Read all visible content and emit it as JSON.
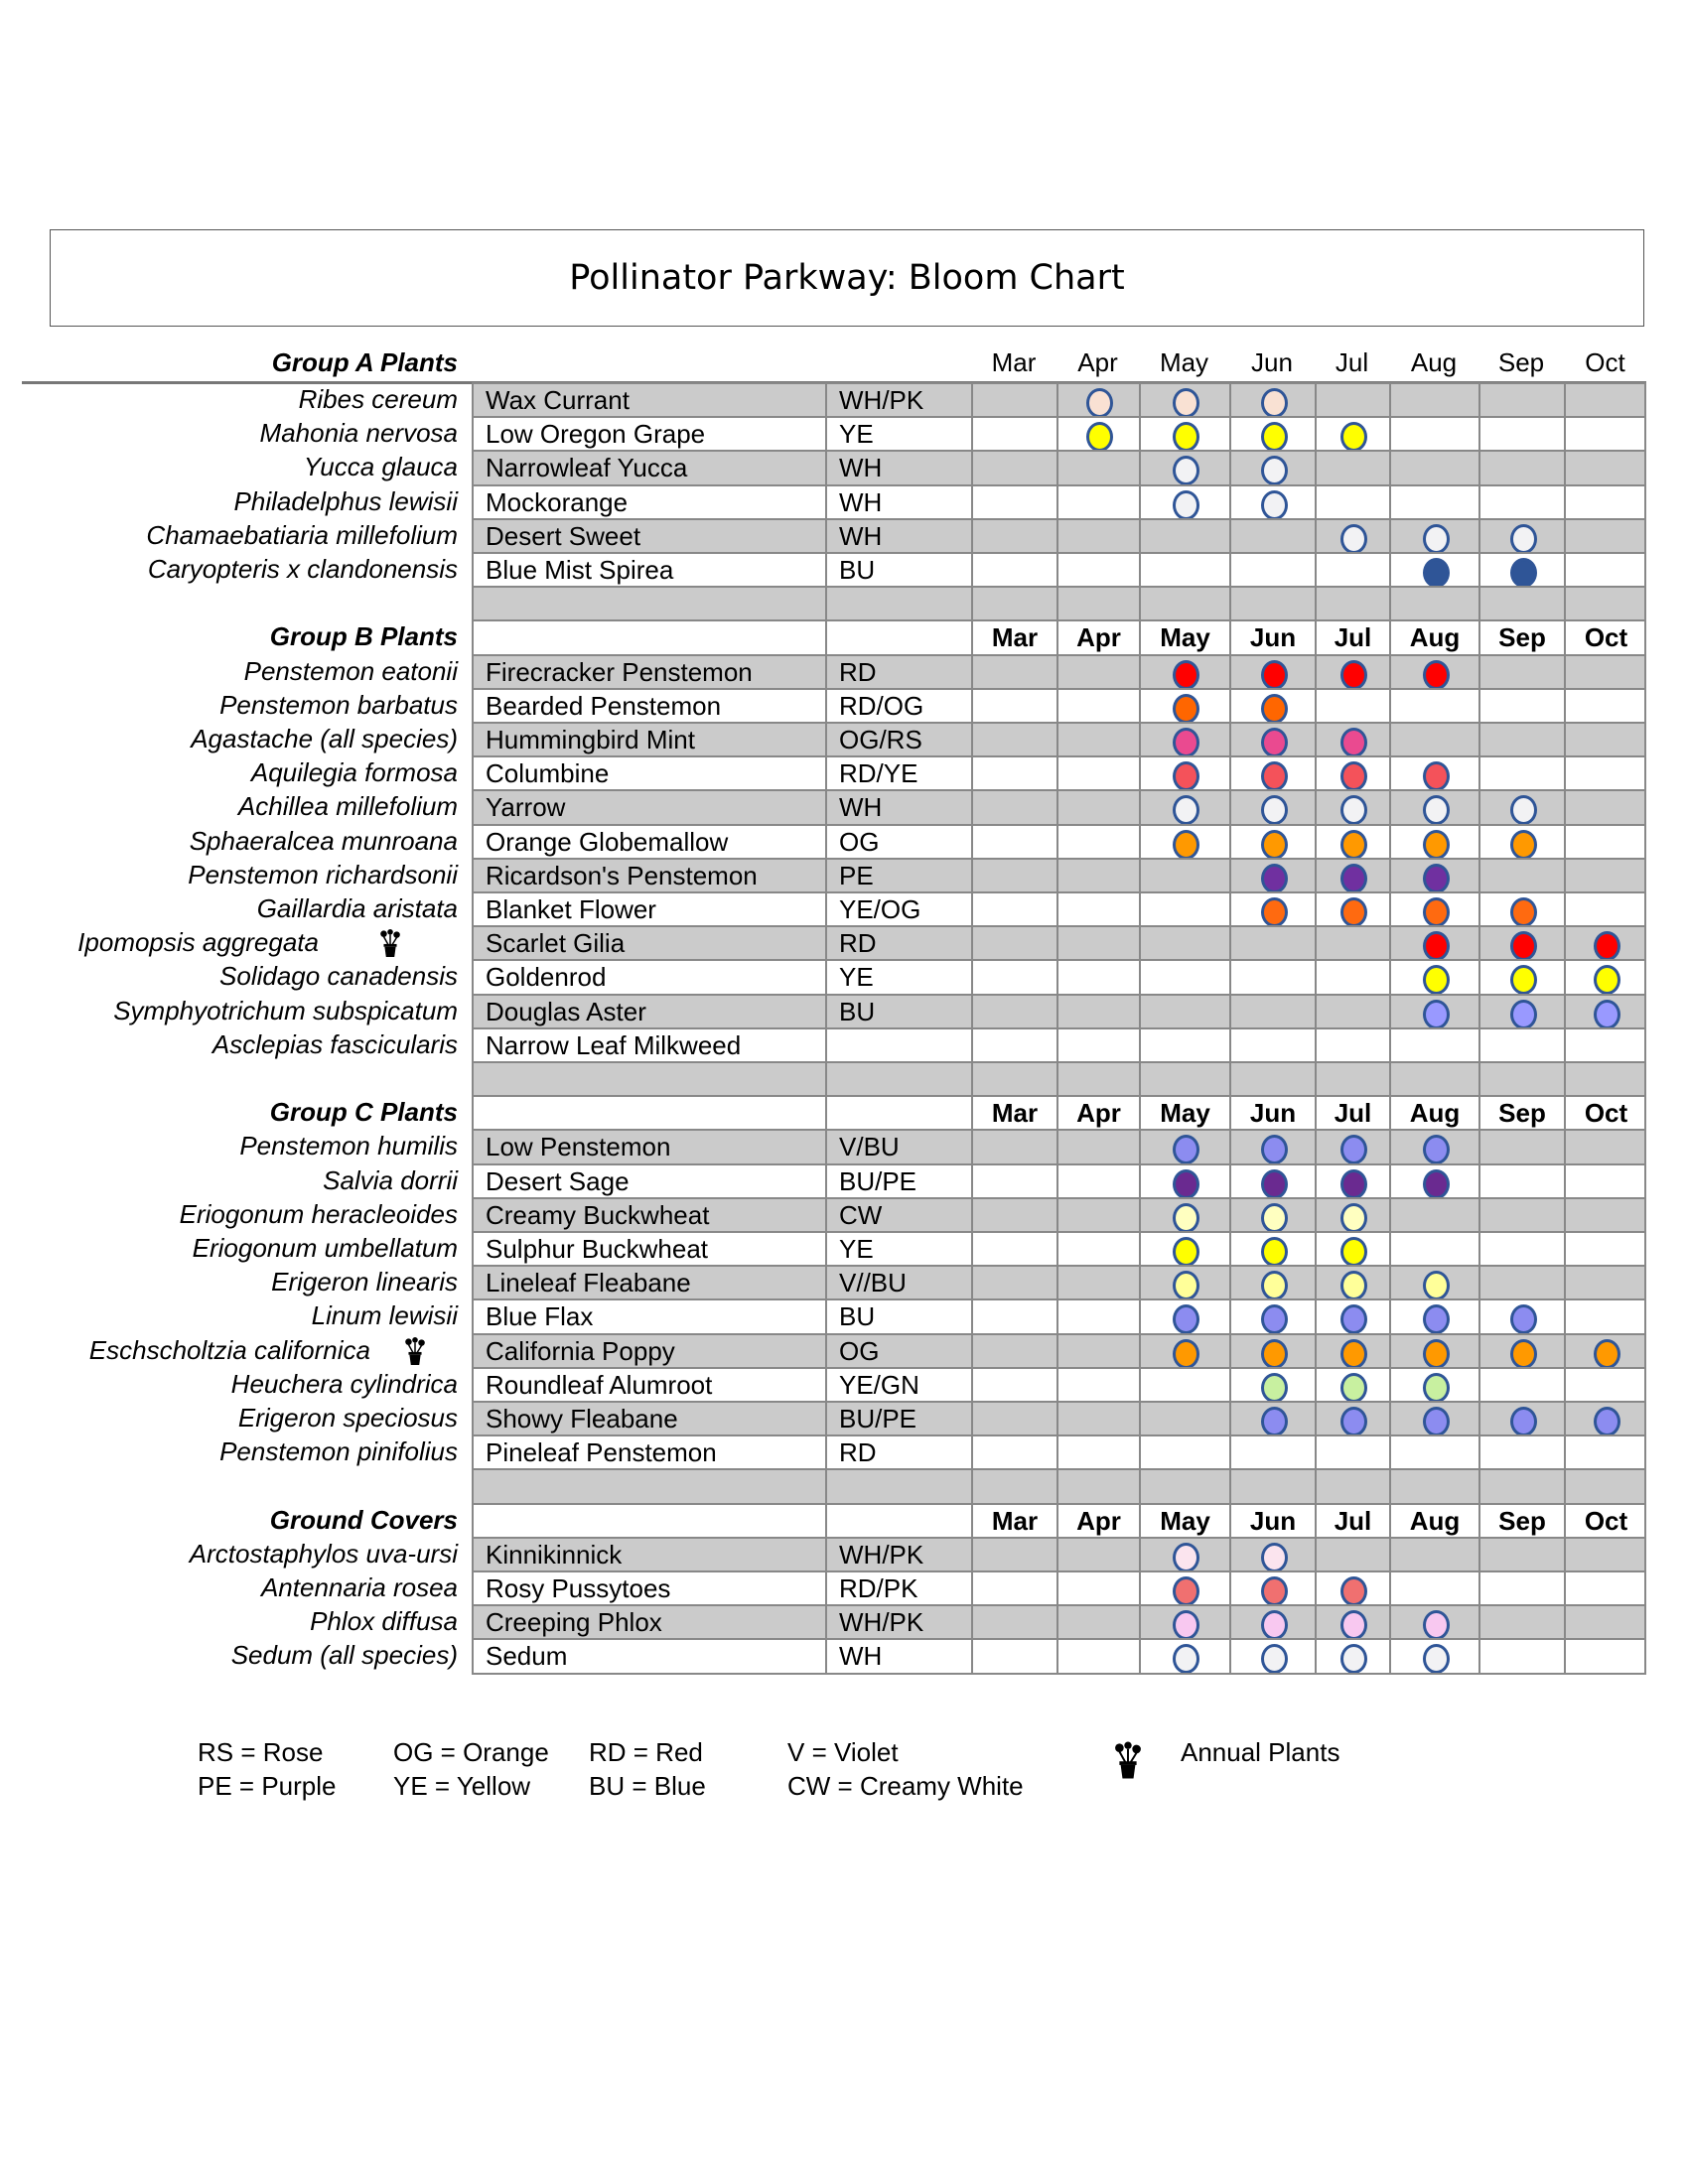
{
  "title": "Pollinator Parkway: Bloom Chart",
  "months": [
    "Mar",
    "Apr",
    "May",
    "Jun",
    "Jul",
    "Aug",
    "Sep",
    "Oct"
  ],
  "dot_border_color": "#2f5597",
  "groups": [
    {
      "title": "Group A Plants",
      "rows": [
        {
          "sci": "Ribes cereum",
          "common": "Wax Currant",
          "code": "WH/PK",
          "color": "#f9e1d3",
          "bloom": [
            "Apr",
            "May",
            "Jun"
          ]
        },
        {
          "sci": "Mahonia nervosa",
          "common": "Low Oregon Grape",
          "code": "YE",
          "color": "#ffff00",
          "bloom": [
            "Apr",
            "May",
            "Jun",
            "Jul"
          ]
        },
        {
          "sci": "Yucca glauca",
          "common": "Narrowleaf Yucca",
          "code": "WH",
          "color": "#f2f2f4",
          "bloom": [
            "May",
            "Jun"
          ]
        },
        {
          "sci": "Philadelphus lewisii",
          "common": "Mockorange",
          "code": "WH",
          "color": "#f2f2f4",
          "bloom": [
            "May",
            "Jun"
          ]
        },
        {
          "sci": "Chamaebatiaria millefolium",
          "common": "Desert Sweet",
          "code": "WH",
          "color": "#f2f2f4",
          "bloom": [
            "Jul",
            "Aug",
            "Sep"
          ]
        },
        {
          "sci": "Caryopteris x clandonensis",
          "common": "Blue Mist Spirea",
          "code": "BU",
          "color": "#2f5597",
          "bloom": [
            "Aug",
            "Sep"
          ]
        }
      ]
    },
    {
      "title": "Group B Plants",
      "rows": [
        {
          "sci": "Penstemon eatonii",
          "common": "Firecracker Penstemon",
          "code": "RD",
          "color": "#ff0000",
          "bloom": [
            "May",
            "Jun",
            "Jul",
            "Aug"
          ]
        },
        {
          "sci": "Penstemon barbatus",
          "common": "Bearded Penstemon",
          "code": "RD/OG",
          "color": "#ff6600",
          "bloom": [
            "May",
            "Jun"
          ]
        },
        {
          "sci": "Agastache (all species)",
          "common": "Hummingbird Mint",
          "code": "OG/RS",
          "color": "#ea4a90",
          "bloom": [
            "May",
            "Jun",
            "Jul"
          ]
        },
        {
          "sci": "Aquilegia formosa",
          "common": "Columbine",
          "code": "RD/YE",
          "color": "#f4525a",
          "bloom": [
            "May",
            "Jun",
            "Jul",
            "Aug"
          ]
        },
        {
          "sci": "Achillea millefolium",
          "common": "Yarrow",
          "code": "WH",
          "color": "#f2f2f4",
          "bloom": [
            "May",
            "Jun",
            "Jul",
            "Aug",
            "Sep"
          ]
        },
        {
          "sci": "Sphaeralcea munroana",
          "common": "Orange Globemallow",
          "code": "OG",
          "color": "#ff9900",
          "bloom": [
            "May",
            "Jun",
            "Jul",
            "Aug",
            "Sep"
          ]
        },
        {
          "sci": "Penstemon richardsonii",
          "common": "Ricardson's Penstemon",
          "code": "PE",
          "color": "#7030a0",
          "bloom": [
            "Jun",
            "Jul",
            "Aug"
          ]
        },
        {
          "sci": "Gaillardia aristata",
          "common": "Blanket Flower",
          "code": "YE/OG",
          "color": "#ff6a10",
          "bloom": [
            "Jun",
            "Jul",
            "Aug",
            "Sep"
          ]
        },
        {
          "sci": "Ipomopsis aggregata",
          "common": "Scarlet Gilia",
          "code": "RD",
          "color": "#ff0000",
          "bloom": [
            "Aug",
            "Sep",
            "Oct"
          ],
          "annual": true
        },
        {
          "sci": "Solidago canadensis",
          "common": "Goldenrod",
          "code": "YE",
          "color": "#ffff00",
          "bloom": [
            "Aug",
            "Sep",
            "Oct"
          ]
        },
        {
          "sci": "Symphyotrichum subspicatum",
          "common": "Douglas Aster",
          "code": "BU",
          "color": "#9999ff",
          "bloom": [
            "Aug",
            "Sep",
            "Oct"
          ]
        },
        {
          "sci": "Asclepias fascicularis",
          "common": "Narrow Leaf Milkweed",
          "code": "",
          "color": "",
          "bloom": []
        }
      ]
    },
    {
      "title": "Group C Plants",
      "rows": [
        {
          "sci": "Penstemon humilis",
          "common": "Low Penstemon",
          "code": "V/BU",
          "color": "#8c8cf0",
          "bloom": [
            "May",
            "Jun",
            "Jul",
            "Aug"
          ]
        },
        {
          "sci": "Salvia dorrii",
          "common": "Desert Sage",
          "code": "BU/PE",
          "color": "#6a2a90",
          "bloom": [
            "May",
            "Jun",
            "Jul",
            "Aug"
          ]
        },
        {
          "sci": "Eriogonum heracleoides",
          "common": "Creamy Buckwheat",
          "code": "CW",
          "color": "#ffffc0",
          "bloom": [
            "May",
            "Jun",
            "Jul"
          ]
        },
        {
          "sci": "Eriogonum umbellatum",
          "common": "Sulphur Buckwheat",
          "code": "YE",
          "color": "#ffff00",
          "bloom": [
            "May",
            "Jun",
            "Jul"
          ]
        },
        {
          "sci": "Erigeron linearis",
          "common": "Lineleaf Fleabane",
          "code": "V//BU",
          "color": "#ffff99",
          "bloom": [
            "May",
            "Jun",
            "Jul",
            "Aug"
          ]
        },
        {
          "sci": "Linum lewisii",
          "common": "Blue Flax",
          "code": "BU",
          "color": "#8c8cf0",
          "bloom": [
            "May",
            "Jun",
            "Jul",
            "Aug",
            "Sep"
          ]
        },
        {
          "sci": "Eschscholtzia californica",
          "common": "California Poppy",
          "code": "OG",
          "color": "#ff9900",
          "bloom": [
            "May",
            "Jun",
            "Jul",
            "Aug",
            "Sep",
            "Oct"
          ],
          "annual": true
        },
        {
          "sci": "Heuchera cylindrica",
          "common": "Roundleaf Alumroot",
          "code": "YE/GN",
          "color": "#c8f0a0",
          "bloom": [
            "Jun",
            "Jul",
            "Aug"
          ]
        },
        {
          "sci": "Erigeron speciosus",
          "common": "Showy Fleabane",
          "code": "BU/PE",
          "color": "#8c8cf0",
          "bloom": [
            "Jun",
            "Jul",
            "Aug",
            "Sep",
            "Oct"
          ]
        },
        {
          "sci": "Penstemon pinifolius",
          "common": "Pineleaf Penstemon",
          "code": "RD",
          "color": "",
          "bloom": []
        }
      ]
    },
    {
      "title": "Ground Covers",
      "rows": [
        {
          "sci": "Arctostaphylos uva-ursi",
          "common": "Kinnikinnick",
          "code": "WH/PK",
          "color": "#fbe4ee",
          "bloom": [
            "May",
            "Jun"
          ]
        },
        {
          "sci": "Antennaria rosea",
          "common": "Rosy Pussytoes",
          "code": "RD/PK",
          "color": "#f07070",
          "bloom": [
            "May",
            "Jun",
            "Jul"
          ]
        },
        {
          "sci": "Phlox diffusa",
          "common": "Creeping Phlox",
          "code": "WH/PK",
          "color": "#f8c8f0",
          "bloom": [
            "May",
            "Jun",
            "Jul",
            "Aug"
          ]
        },
        {
          "sci": "Sedum (all species)",
          "common": "Sedum",
          "code": "WH",
          "color": "#f2f2f4",
          "bloom": [
            "May",
            "Jun",
            "Jul",
            "Aug"
          ]
        }
      ]
    }
  ],
  "legend": {
    "items": [
      "RS = Rose",
      "PE = Purple",
      "OG = Orange",
      "YE = Yellow",
      "RD = Red",
      "BU = Blue",
      "V = Violet",
      "CW = Creamy White"
    ],
    "annual_icon": "potted-flower-icon",
    "annual_label": "Annual Plants"
  }
}
